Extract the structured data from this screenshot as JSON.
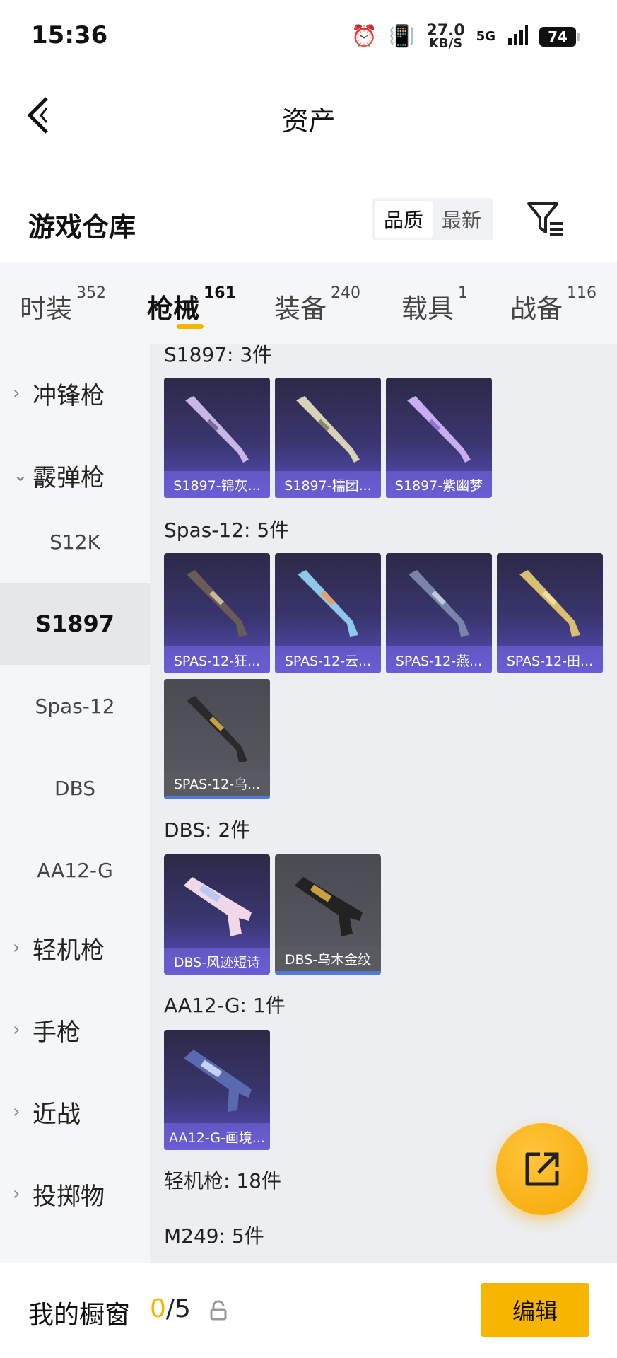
{
  "status_bar": {
    "time": "15:36",
    "speed_value": "27.0",
    "speed_unit": "KB/S",
    "network": "5G",
    "battery": "74"
  },
  "header": {
    "title": "资产"
  },
  "warehouse": {
    "title": "游戏仓库",
    "sort_options": [
      "品质",
      "最新"
    ],
    "sort_selected": "品质"
  },
  "tabs": [
    {
      "label": "时装",
      "count": "352",
      "active": false
    },
    {
      "label": "枪械",
      "count": "161",
      "active": true
    },
    {
      "label": "装备",
      "count": "240",
      "active": false
    },
    {
      "label": "载具",
      "count": "1",
      "active": false
    },
    {
      "label": "战备",
      "count": "116",
      "active": false
    }
  ],
  "sidebar": {
    "groups": [
      {
        "label": "冲锋枪",
        "expanded": false
      },
      {
        "label": "霰弹枪",
        "expanded": true
      },
      {
        "label": "轻机枪",
        "expanded": false
      },
      {
        "label": "手枪",
        "expanded": false
      },
      {
        "label": "近战",
        "expanded": false
      },
      {
        "label": "投掷物",
        "expanded": false
      }
    ],
    "sub_items": [
      "S12K",
      "S1897",
      "Spas-12",
      "DBS",
      "AA12-G"
    ],
    "active_sub": "S1897"
  },
  "content": {
    "groups": [
      {
        "title": "S1897: 3件",
        "items": [
          {
            "name": "S1897-锦灰...",
            "rarity": "purple"
          },
          {
            "name": "S1897-糯团...",
            "rarity": "purple"
          },
          {
            "name": "S1897-紫幽梦",
            "rarity": "purple"
          }
        ]
      },
      {
        "title": "Spas-12: 5件",
        "items": [
          {
            "name": "SPAS-12-狂...",
            "rarity": "purple"
          },
          {
            "name": "SPAS-12-云...",
            "rarity": "purple"
          },
          {
            "name": "SPAS-12-燕...",
            "rarity": "purple"
          },
          {
            "name": "SPAS-12-田...",
            "rarity": "purple"
          },
          {
            "name": "SPAS-12-乌...",
            "rarity": "grey"
          }
        ]
      },
      {
        "title": "DBS: 2件",
        "items": [
          {
            "name": "DBS-风迹短诗",
            "rarity": "purple"
          },
          {
            "name": "DBS-乌木金纹",
            "rarity": "grey"
          }
        ]
      },
      {
        "title": "AA12-G: 1件",
        "items": [
          {
            "name": "AA12-G-画境...",
            "rarity": "purple"
          }
        ]
      }
    ],
    "trailing_titles": [
      "轻机枪: 18件",
      "M249: 5件"
    ]
  },
  "bottom_bar": {
    "label": "我的橱窗",
    "used": "0",
    "separator": "/",
    "total": "5",
    "edit_label": "编辑"
  },
  "colors": {
    "accent": "#f7b500",
    "purple_card": "#5a4ec4",
    "grey_card": "#5a5b62",
    "background": "#eceef1"
  }
}
